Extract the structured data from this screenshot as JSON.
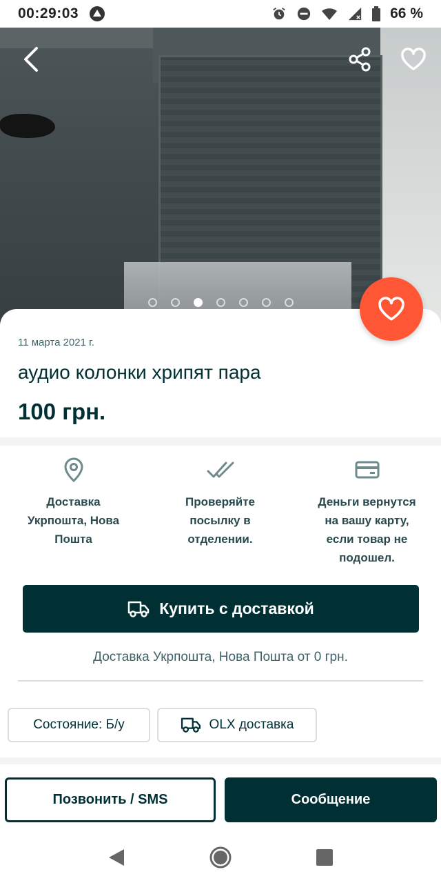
{
  "status_bar": {
    "time": "00:29:03",
    "battery": "66 %",
    "icons": [
      "alert-triangle-icon",
      "alarm-icon",
      "do-not-disturb-icon",
      "wifi-icon",
      "signal-icon",
      "battery-icon"
    ]
  },
  "photo": {
    "carousel_count": 7,
    "active_index": 2,
    "icons": [
      "back-arrow-icon",
      "share-icon",
      "heart-icon"
    ]
  },
  "listing": {
    "date": "11 марта 2021 г.",
    "title": "аудио колонки хрипят пара",
    "price": "100 грн."
  },
  "features": [
    {
      "icon": "location-pin-icon",
      "text": "Доставка\nУкрпошта, Нова\nПошта"
    },
    {
      "icon": "double-check-icon",
      "text": "Проверяйте\nпосылку в\nотделении."
    },
    {
      "icon": "credit-card-icon",
      "text": "Деньги вернутся\nна вашу карту,\nесли товар не\nподошел."
    }
  ],
  "buy": {
    "label": "Купить с доставкой",
    "note": "Доставка Укрпошта, Нова Пошта от 0 грн."
  },
  "chips": {
    "condition": "Состояние: Б/у",
    "olx_delivery": "OLX доставка"
  },
  "actions": {
    "call": "Позвонить / SMS",
    "message": "Сообщение"
  },
  "colors": {
    "primary": "#002f34",
    "accent": "#ff5636",
    "background": "#ffffff",
    "divider": "#f2f4f5"
  }
}
